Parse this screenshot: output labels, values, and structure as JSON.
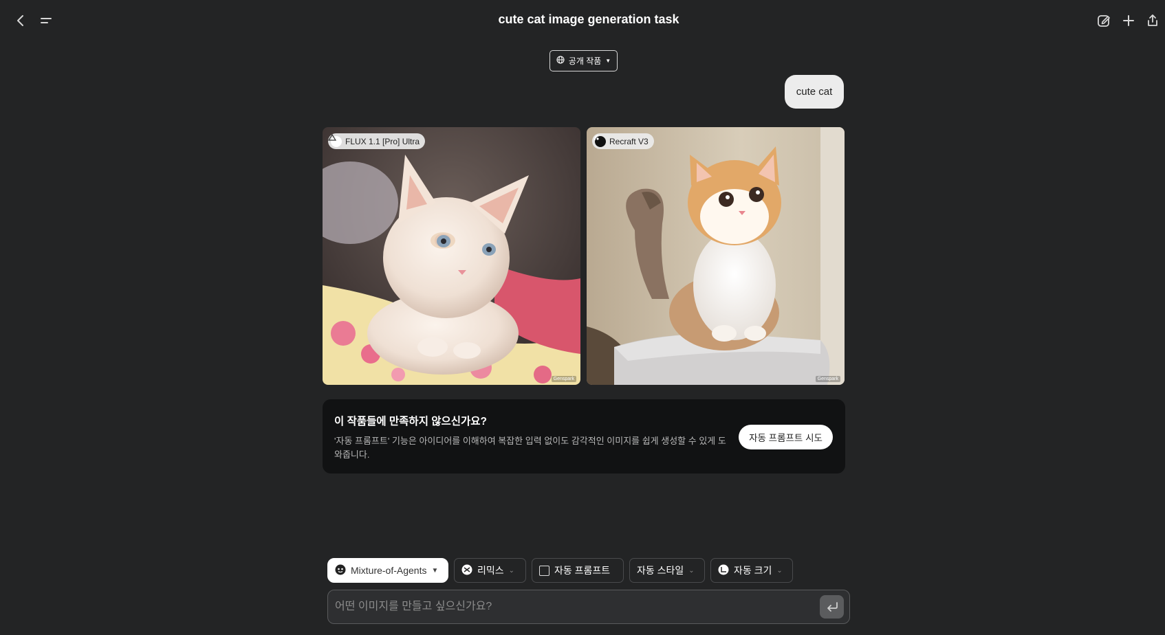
{
  "header": {
    "title": "cute cat image generation task",
    "back_icon": "chevron-left-icon",
    "menu_icon": "menu-icon",
    "actions": [
      "edit-icon",
      "plus-icon",
      "share-icon"
    ]
  },
  "visibility": {
    "label": "공개 작품",
    "icon": "globe-icon"
  },
  "prompt": {
    "text": "cute cat"
  },
  "results": [
    {
      "model": "FLUX 1.1 [Pro] Ultra",
      "watermark": "Genspark",
      "subject": "white fluffy kitten lying on floral blanket"
    },
    {
      "model": "Recraft V3",
      "watermark": "Genspark",
      "subject": "orange and white fluffy kitten sitting on cushion"
    }
  ],
  "promo": {
    "title": "이 작품들에 만족하지 않으신가요?",
    "description": "'자동 프롬프트' 기능은 아이디어를 이해하여 복잡한 입력 없이도 감각적인 이미지를 쉽게 생성할 수 있게 도와줍니다.",
    "button": "자동 프롬프트 시도"
  },
  "toolbar": {
    "model": "Mixture-of-Agents",
    "remix": "리믹스",
    "auto_prompt": "자동 프롬프트",
    "auto_style": "자동 스타일",
    "auto_size": "자동 크기"
  },
  "input": {
    "placeholder": "어떤 이미지를 만들고 싶으신가요?",
    "value": ""
  },
  "colors": {
    "background": "#232425",
    "promo_bg": "#111213",
    "chip_border": "#4a4b4d"
  }
}
